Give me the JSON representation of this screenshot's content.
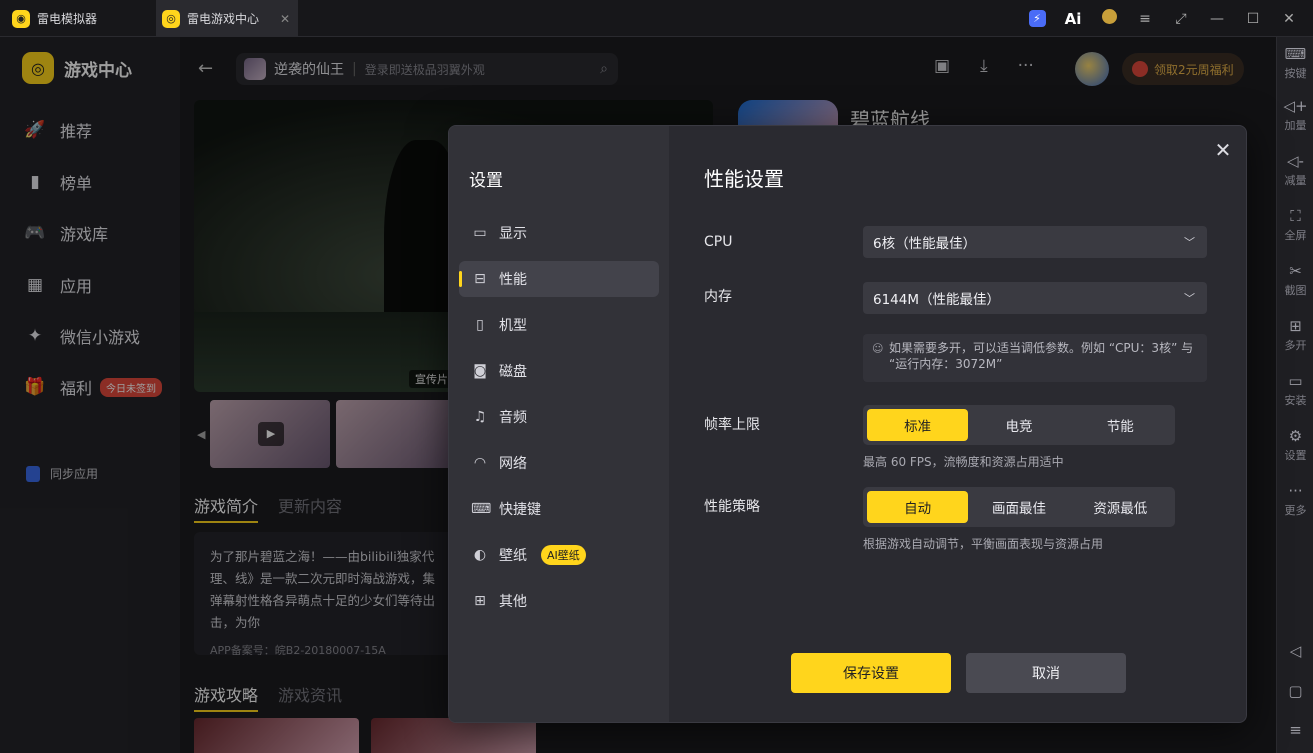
{
  "window": {
    "tabs": [
      {
        "label": "雷电模拟器"
      },
      {
        "label": "雷电游戏中心"
      }
    ],
    "ai_label": "Ai",
    "close_tab": "✕"
  },
  "right_toolbar": {
    "items": [
      {
        "label": "按键",
        "icon": "keyboard-icon"
      },
      {
        "label": "加量",
        "icon": "volume-up-icon"
      },
      {
        "label": "减量",
        "icon": "volume-down-icon"
      },
      {
        "label": "全屏",
        "icon": "fullscreen-icon"
      },
      {
        "label": "截图",
        "icon": "scissors-icon"
      },
      {
        "label": "多开",
        "icon": "multi-instance-icon"
      },
      {
        "label": "安装",
        "icon": "apk-install-icon"
      },
      {
        "label": "设置",
        "icon": "gear-icon"
      },
      {
        "label": "更多",
        "icon": "more-icon"
      }
    ]
  },
  "sidebar": {
    "brand": "游戏中心",
    "items": [
      {
        "label": "推荐",
        "icon": "rocket-icon"
      },
      {
        "label": "榜单",
        "icon": "chart-icon"
      },
      {
        "label": "游戏库",
        "icon": "gamepad-icon"
      },
      {
        "label": "应用",
        "icon": "apps-icon"
      },
      {
        "label": "微信小游戏",
        "icon": "wechat-game-icon"
      },
      {
        "label": "福利",
        "icon": "gift-icon"
      }
    ],
    "welfare_badge": "今日未签到",
    "sync_label": "同步应用"
  },
  "header": {
    "search_game": "逆袭的仙王",
    "search_placeholder": "登录即送极品羽翼外观",
    "welfare_btn": "领取2元周福利"
  },
  "game": {
    "name": "碧蓝航线",
    "promo_tag": "宣传片",
    "intro_tabs": [
      "游戏简介",
      "更新内容"
    ],
    "intro_text": "为了那片碧蓝之海！——由bilibili独家代理、线》是一款二次元即时海战游戏，集弹幕射性格各异萌点十足的少女们等待出击，为你",
    "record": "APP备案号：皖B2-20180007-15A",
    "guide_tabs": [
      "游戏攻略",
      "游戏资讯"
    ]
  },
  "settings_modal": {
    "title": "设置",
    "menu": [
      {
        "label": "显示",
        "icon": "monitor-icon"
      },
      {
        "label": "性能",
        "icon": "performance-icon"
      },
      {
        "label": "机型",
        "icon": "phone-icon"
      },
      {
        "label": "磁盘",
        "icon": "disk-icon"
      },
      {
        "label": "音频",
        "icon": "audio-icon"
      },
      {
        "label": "网络",
        "icon": "wifi-icon"
      },
      {
        "label": "快捷键",
        "icon": "keyboard-icon"
      },
      {
        "label": "壁纸",
        "icon": "palette-icon"
      },
      {
        "label": "其他",
        "icon": "grid-icon"
      }
    ],
    "wallpaper_badge": "AI壁纸",
    "selected_menu": "性能",
    "panel_title": "性能设置",
    "cpu": {
      "label": "CPU",
      "value": "6核（性能最佳）"
    },
    "memory": {
      "label": "内存",
      "value": "6144M（性能最佳）"
    },
    "hint": "如果需要多开，可以适当调低参数。例如 “CPU：3核” 与 “运行内存：3072M”",
    "fps": {
      "label": "帧率上限",
      "options": [
        "标准",
        "电竞",
        "节能"
      ],
      "selected": "标准",
      "desc": "最高 60 FPS，流畅度和资源占用适中"
    },
    "strategy": {
      "label": "性能策略",
      "options": [
        "自动",
        "画面最佳",
        "资源最低"
      ],
      "selected": "自动",
      "desc": "根据游戏自动调节，平衡画面表现与资源占用"
    },
    "save_label": "保存设置",
    "cancel_label": "取消",
    "accent": "#ffd51c"
  }
}
